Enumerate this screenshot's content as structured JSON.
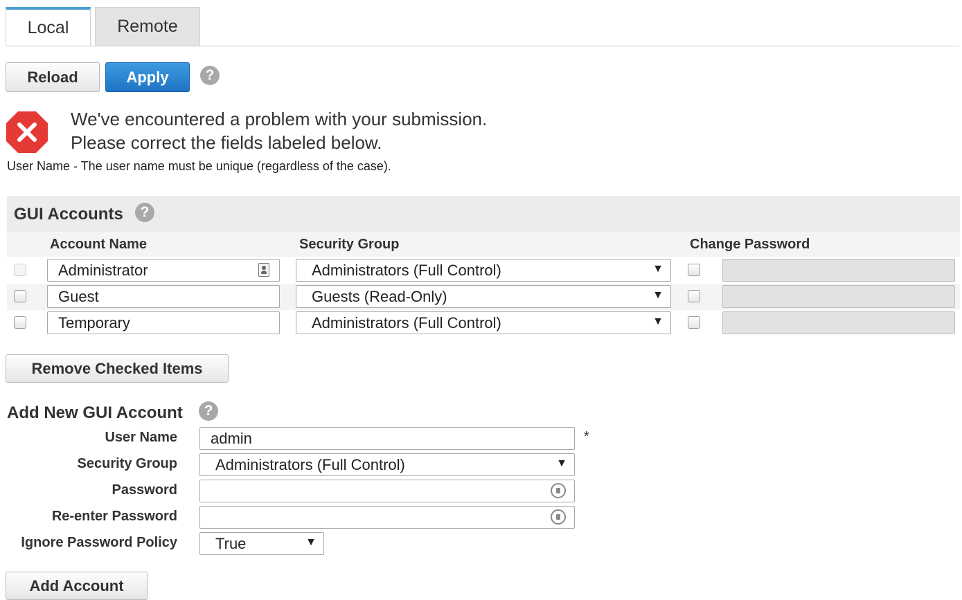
{
  "tabs": [
    {
      "label": "Local",
      "active": true
    },
    {
      "label": "Remote",
      "active": false
    }
  ],
  "toolbar": {
    "reload_label": "Reload",
    "apply_label": "Apply",
    "help_glyph": "?"
  },
  "error": {
    "line1": "We've encountered a problem with your submission.",
    "line2": "Please correct the fields labeled below.",
    "detail": "User Name - The user name must be unique (regardless of the case).",
    "icon": "error-x-icon",
    "color": "#e53935"
  },
  "gui_accounts": {
    "title": "GUI Accounts",
    "columns": {
      "account_name": "Account Name",
      "security_group": "Security Group",
      "change_password": "Change Password"
    },
    "rows": [
      {
        "name": "Administrator",
        "group": "Administrators (Full Control)",
        "checkbox_disabled": true
      },
      {
        "name": "Guest",
        "group": "Guests (Read-Only)",
        "checkbox_disabled": false
      },
      {
        "name": "Temporary",
        "group": "Administrators (Full Control)",
        "checkbox_disabled": false
      }
    ],
    "remove_label": "Remove Checked Items"
  },
  "add_account": {
    "title": "Add New GUI Account",
    "user_name_label": "User Name",
    "user_name_value": "admin",
    "required_mark": "*",
    "security_group_label": "Security Group",
    "security_group_value": "Administrators (Full Control)",
    "password_label": "Password",
    "reenter_password_label": "Re-enter Password",
    "ignore_policy_label": "Ignore Password Policy",
    "ignore_policy_value": "True",
    "add_label": "Add Account"
  },
  "colors": {
    "accent": "#4a9fd0",
    "apply_button": "#1f73c4",
    "error": "#e53935"
  }
}
